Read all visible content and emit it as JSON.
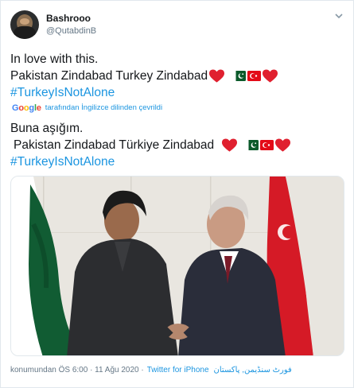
{
  "author": {
    "display_name": "Bashrooo",
    "handle": "@QutabdinB"
  },
  "tweet": {
    "line1": "In love with this.",
    "line2": "Pakistan Zindabad Turkey Zindabad",
    "hashtag": "#TurkeyIsNotAlone"
  },
  "translation": {
    "google_label": "Google",
    "notice": "tarafından İngilizce dilinden çevrildi",
    "line1": "Buna aşığım.",
    "line2": "Pakistan Zindabad Türkiye Zindabad",
    "hashtag": "#TurkeyIsNotAlone"
  },
  "footer": {
    "meta": "konumundan ÖS 6:00 · 11 Ağu 2020 ·",
    "client": "Twitter for iPhone",
    "location": "فورٹ سنڈیمن, پاکستان"
  },
  "icons": {
    "heart": "red-heart-emoji",
    "flag_pk": "pakistan-flag-emoji",
    "flag_tr": "turkey-flag-emoji",
    "caret": "chevron-down-icon"
  },
  "colors": {
    "link": "#1b95e0",
    "muted": "#657786",
    "heart": "#e0202f"
  }
}
